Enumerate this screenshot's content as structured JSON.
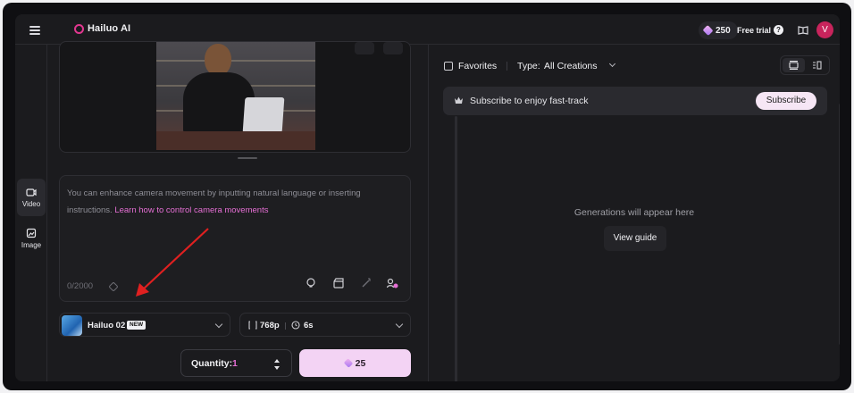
{
  "header": {
    "logo_text": "Hailuo AI",
    "credits": "250",
    "free_trial": "Free trial",
    "help": "?",
    "avatar_initial": "V"
  },
  "rail": {
    "items": [
      {
        "label": "Video",
        "icon": "video-icon",
        "active": true
      },
      {
        "label": "Image",
        "icon": "image-icon",
        "active": false
      }
    ]
  },
  "prompt": {
    "placeholder_text": "You can enhance camera movement by inputting natural language or inserting instructions.",
    "link_text": "Learn how to control camera movements",
    "char_count": "0/2000"
  },
  "model": {
    "name": "Hailuo 02",
    "badge": "NEW"
  },
  "settings": {
    "resolution": "768p",
    "duration": "6s"
  },
  "quantity": {
    "label": "Quantity:",
    "value": "1"
  },
  "generate": {
    "cost": "25"
  },
  "filters": {
    "favorites_label": "Favorites",
    "type_label": "Type:",
    "type_value": "All Creations"
  },
  "banner": {
    "text": "Subscribe to enjoy fast-track",
    "button": "Subscribe"
  },
  "empty_state": {
    "text": "Generations will appear here",
    "button": "View guide"
  },
  "colors": {
    "accent": "#e56fd4",
    "generate_bg": "#f3d3f4",
    "avatar_bg": "#c8245c",
    "annotation_arrow": "#e02020"
  }
}
